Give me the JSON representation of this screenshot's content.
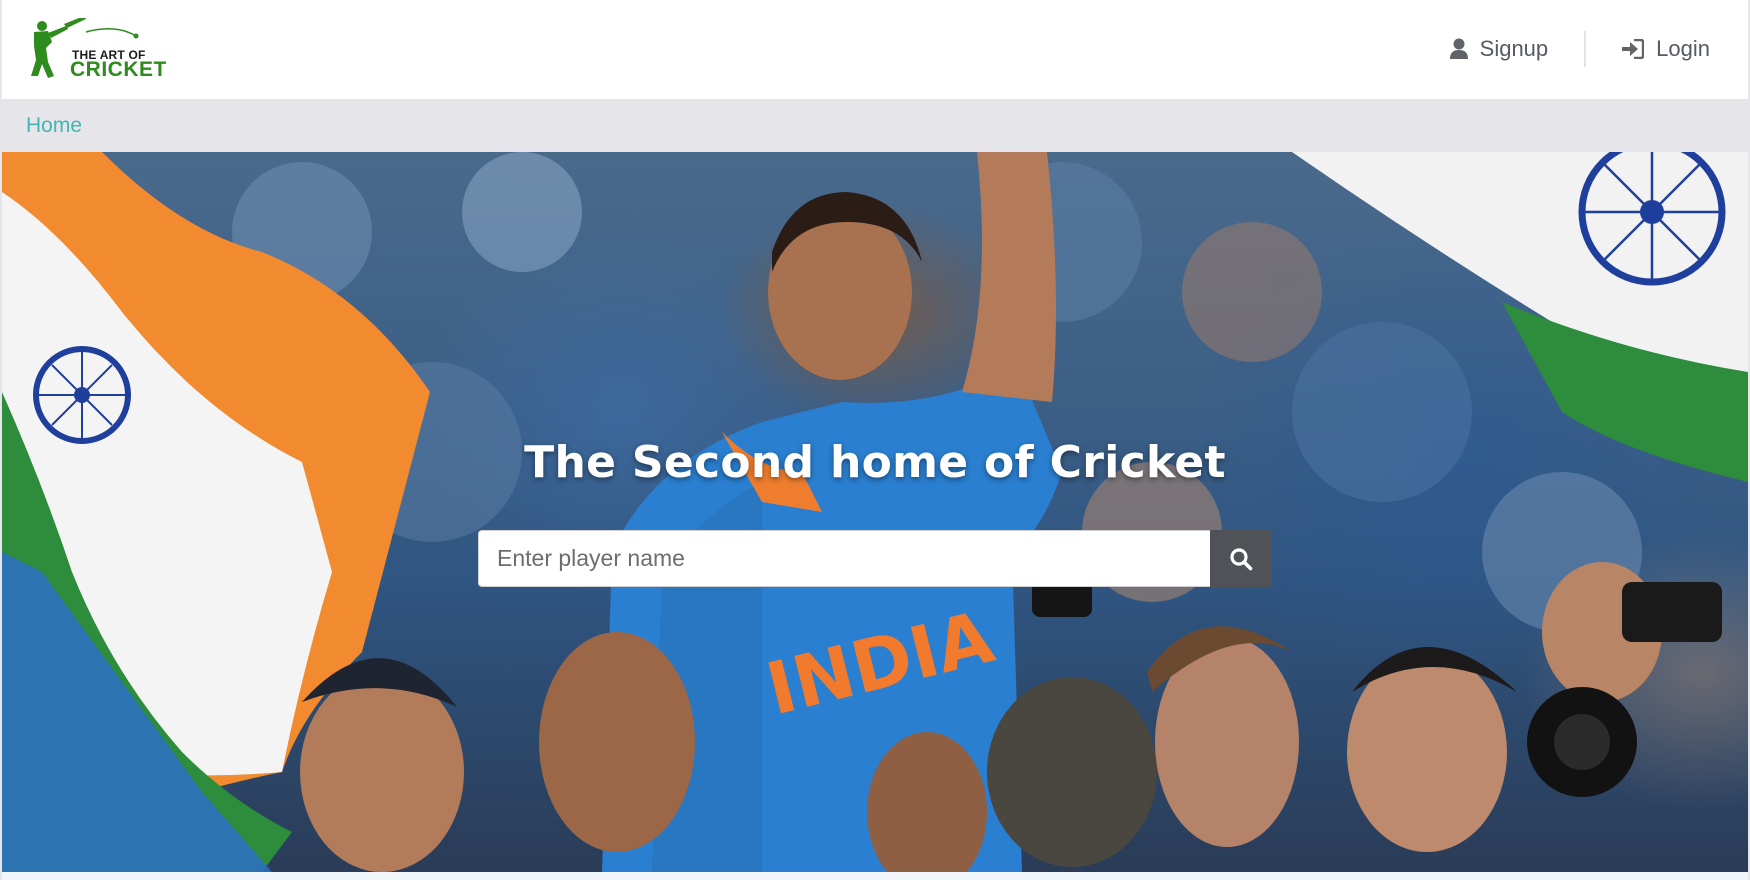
{
  "header": {
    "logo": {
      "line1": "THE ART OF",
      "line2": "CRICKET",
      "icon": "batsman-logo-icon",
      "brand_color": "#2e8b1e"
    },
    "nav": [
      {
        "label": "Signup",
        "icon": "user-icon"
      },
      {
        "label": "Login",
        "icon": "sign-in-icon"
      }
    ]
  },
  "breadcrumb": {
    "items": [
      {
        "label": "Home"
      }
    ],
    "link_color": "#42b6b4"
  },
  "hero": {
    "title": "The Second home of Cricket",
    "search": {
      "placeholder": "Enter player name",
      "value": "",
      "button_icon": "search-icon"
    },
    "jersey_text": "INDIA"
  }
}
